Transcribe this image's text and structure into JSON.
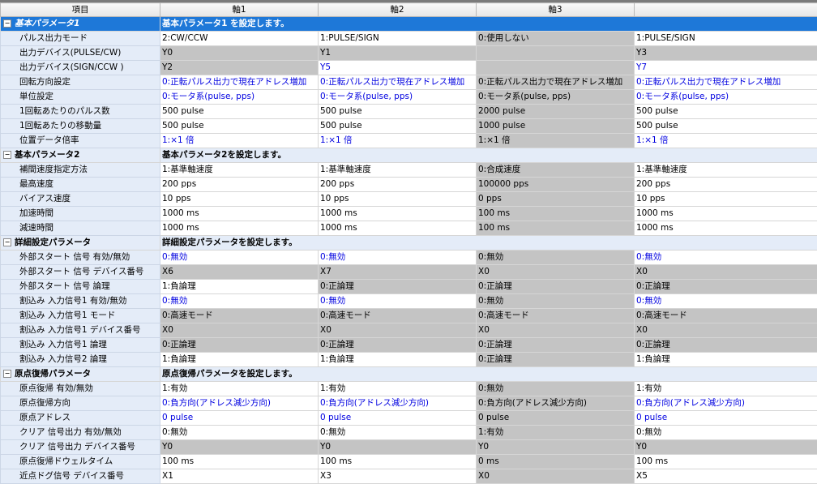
{
  "header": {
    "item": "項目",
    "axis1": "軸1",
    "axis2": "軸2",
    "axis3": "軸3",
    "axis4": ""
  },
  "groups": [
    {
      "title": "基本パラメータ1",
      "desc": "基本パラメータ1 を設定します。",
      "selected": true,
      "rows": [
        {
          "name": "パルス出力モード",
          "v": [
            [
              "2:CW/CCW",
              "w"
            ],
            [
              "1:PULSE/SIGN",
              "w"
            ],
            [
              "0:使用しない",
              "g"
            ],
            [
              "1:PULSE/SIGN",
              "w"
            ]
          ]
        },
        {
          "name": "出力デバイス(PULSE/CW)",
          "v": [
            [
              "Y0",
              "g"
            ],
            [
              "Y1",
              "g"
            ],
            [
              "",
              "g"
            ],
            [
              "Y3",
              "g"
            ]
          ]
        },
        {
          "name": "出力デバイス(SIGN/CCW )",
          "v": [
            [
              "Y2",
              "g"
            ],
            [
              "Y5",
              "wb"
            ],
            [
              "",
              "g"
            ],
            [
              "Y7",
              "wb"
            ]
          ]
        },
        {
          "name": "回転方向設定",
          "v": [
            [
              "0:正転パルス出力で現在アドレス増加",
              "wb"
            ],
            [
              "0:正転パルス出力で現在アドレス増加",
              "wb"
            ],
            [
              "0:正転パルス出力で現在アドレス増加",
              "g"
            ],
            [
              "0:正転パルス出力で現在アドレス増加",
              "wb"
            ]
          ]
        },
        {
          "name": "単位設定",
          "v": [
            [
              "0:モータ系(pulse, pps)",
              "wb"
            ],
            [
              "0:モータ系(pulse, pps)",
              "wb"
            ],
            [
              "0:モータ系(pulse, pps)",
              "g"
            ],
            [
              "0:モータ系(pulse, pps)",
              "wb"
            ]
          ]
        },
        {
          "name": "1回転あたりのパルス数",
          "v": [
            [
              "500 pulse",
              "w"
            ],
            [
              "500 pulse",
              "w"
            ],
            [
              "2000 pulse",
              "g"
            ],
            [
              "500 pulse",
              "w"
            ]
          ]
        },
        {
          "name": "1回転あたりの移動量",
          "v": [
            [
              "500 pulse",
              "w"
            ],
            [
              "500 pulse",
              "w"
            ],
            [
              "1000 pulse",
              "g"
            ],
            [
              "500 pulse",
              "w"
            ]
          ]
        },
        {
          "name": "位置データ倍率",
          "v": [
            [
              "1:×1 倍",
              "wb"
            ],
            [
              "1:×1 倍",
              "wb"
            ],
            [
              "1:×1 倍",
              "g"
            ],
            [
              "1:×1 倍",
              "wb"
            ]
          ]
        }
      ]
    },
    {
      "title": "基本パラメータ2",
      "desc": "基本パラメータ2を設定します。",
      "selected": false,
      "rows": [
        {
          "name": "補間速度指定方法",
          "v": [
            [
              "1:基準軸速度",
              "w"
            ],
            [
              "1:基準軸速度",
              "w"
            ],
            [
              "0:合成速度",
              "g"
            ],
            [
              "1:基準軸速度",
              "w"
            ]
          ]
        },
        {
          "name": "最高速度",
          "v": [
            [
              "200 pps",
              "w"
            ],
            [
              "200 pps",
              "w"
            ],
            [
              "100000 pps",
              "g"
            ],
            [
              "200 pps",
              "w"
            ]
          ]
        },
        {
          "name": "バイアス速度",
          "v": [
            [
              "10 pps",
              "w"
            ],
            [
              "10 pps",
              "w"
            ],
            [
              "0 pps",
              "g"
            ],
            [
              "10 pps",
              "w"
            ]
          ]
        },
        {
          "name": "加速時間",
          "v": [
            [
              "1000 ms",
              "w"
            ],
            [
              "1000 ms",
              "w"
            ],
            [
              "100 ms",
              "g"
            ],
            [
              "1000 ms",
              "w"
            ]
          ]
        },
        {
          "name": "減速時間",
          "v": [
            [
              "1000 ms",
              "w"
            ],
            [
              "1000 ms",
              "w"
            ],
            [
              "100 ms",
              "g"
            ],
            [
              "1000 ms",
              "w"
            ]
          ]
        }
      ]
    },
    {
      "title": "詳細設定パラメータ",
      "desc": "詳細設定パラメータを設定します。",
      "selected": false,
      "rows": [
        {
          "name": "外部スタート 信号 有効/無効",
          "v": [
            [
              "0:無効",
              "wb"
            ],
            [
              "0:無効",
              "wb"
            ],
            [
              "0:無効",
              "g"
            ],
            [
              "0:無効",
              "wb"
            ]
          ]
        },
        {
          "name": "外部スタート 信号 デバイス番号",
          "v": [
            [
              "X6",
              "g"
            ],
            [
              "X7",
              "g"
            ],
            [
              "X0",
              "g"
            ],
            [
              "X0",
              "g"
            ]
          ]
        },
        {
          "name": "外部スタート 信号 論理",
          "v": [
            [
              "1:負論理",
              "w"
            ],
            [
              "0:正論理",
              "g"
            ],
            [
              "0:正論理",
              "g"
            ],
            [
              "0:正論理",
              "g"
            ]
          ]
        },
        {
          "name": "割込み 入力信号1 有効/無効",
          "v": [
            [
              "0:無効",
              "wb"
            ],
            [
              "0:無効",
              "wb"
            ],
            [
              "0:無効",
              "g"
            ],
            [
              "0:無効",
              "wb"
            ]
          ]
        },
        {
          "name": "割込み 入力信号1 モード",
          "v": [
            [
              "0:高速モード",
              "g"
            ],
            [
              "0:高速モード",
              "g"
            ],
            [
              "0:高速モード",
              "g"
            ],
            [
              "0:高速モード",
              "g"
            ]
          ]
        },
        {
          "name": "割込み 入力信号1 デバイス番号",
          "v": [
            [
              "X0",
              "g"
            ],
            [
              "X0",
              "g"
            ],
            [
              "X0",
              "g"
            ],
            [
              "X0",
              "g"
            ]
          ]
        },
        {
          "name": "割込み 入力信号1 論理",
          "v": [
            [
              "0:正論理",
              "g"
            ],
            [
              "0:正論理",
              "g"
            ],
            [
              "0:正論理",
              "g"
            ],
            [
              "0:正論理",
              "g"
            ]
          ]
        },
        {
          "name": "割込み 入力信号2 論理",
          "v": [
            [
              "1:負論理",
              "w"
            ],
            [
              "1:負論理",
              "w"
            ],
            [
              "0:正論理",
              "g"
            ],
            [
              "1:負論理",
              "w"
            ]
          ]
        }
      ]
    },
    {
      "title": "原点復帰パラメータ",
      "desc": "原点復帰パラメータを設定します。",
      "selected": false,
      "rows": [
        {
          "name": "原点復帰 有効/無効",
          "v": [
            [
              "1:有効",
              "w"
            ],
            [
              "1:有効",
              "w"
            ],
            [
              "0:無効",
              "g"
            ],
            [
              "1:有効",
              "w"
            ]
          ]
        },
        {
          "name": "原点復帰方向",
          "v": [
            [
              "0:負方向(アドレス減少方向)",
              "wb"
            ],
            [
              "0:負方向(アドレス減少方向)",
              "wb"
            ],
            [
              "0:負方向(アドレス減少方向)",
              "g"
            ],
            [
              "0:負方向(アドレス減少方向)",
              "wb"
            ]
          ]
        },
        {
          "name": "原点アドレス",
          "v": [
            [
              "0 pulse",
              "wb"
            ],
            [
              "0 pulse",
              "wb"
            ],
            [
              "0 pulse",
              "g"
            ],
            [
              "0 pulse",
              "wb"
            ]
          ]
        },
        {
          "name": "クリア 信号出力 有効/無効",
          "v": [
            [
              "0:無効",
              "w"
            ],
            [
              "0:無効",
              "w"
            ],
            [
              "1:有効",
              "g"
            ],
            [
              "0:無効",
              "w"
            ]
          ]
        },
        {
          "name": "クリア 信号出力 デバイス番号",
          "v": [
            [
              "Y0",
              "g"
            ],
            [
              "Y0",
              "g"
            ],
            [
              "Y0",
              "g"
            ],
            [
              "Y0",
              "g"
            ]
          ]
        },
        {
          "name": "原点復帰ドウェルタイム",
          "v": [
            [
              "100 ms",
              "w"
            ],
            [
              "100 ms",
              "w"
            ],
            [
              "0 ms",
              "g"
            ],
            [
              "100 ms",
              "w"
            ]
          ]
        },
        {
          "name": "近点ドグ信号 デバイス番号",
          "v": [
            [
              "X1",
              "w"
            ],
            [
              "X3",
              "w"
            ],
            [
              "X0",
              "g"
            ],
            [
              "X5",
              "w"
            ]
          ]
        }
      ]
    }
  ]
}
